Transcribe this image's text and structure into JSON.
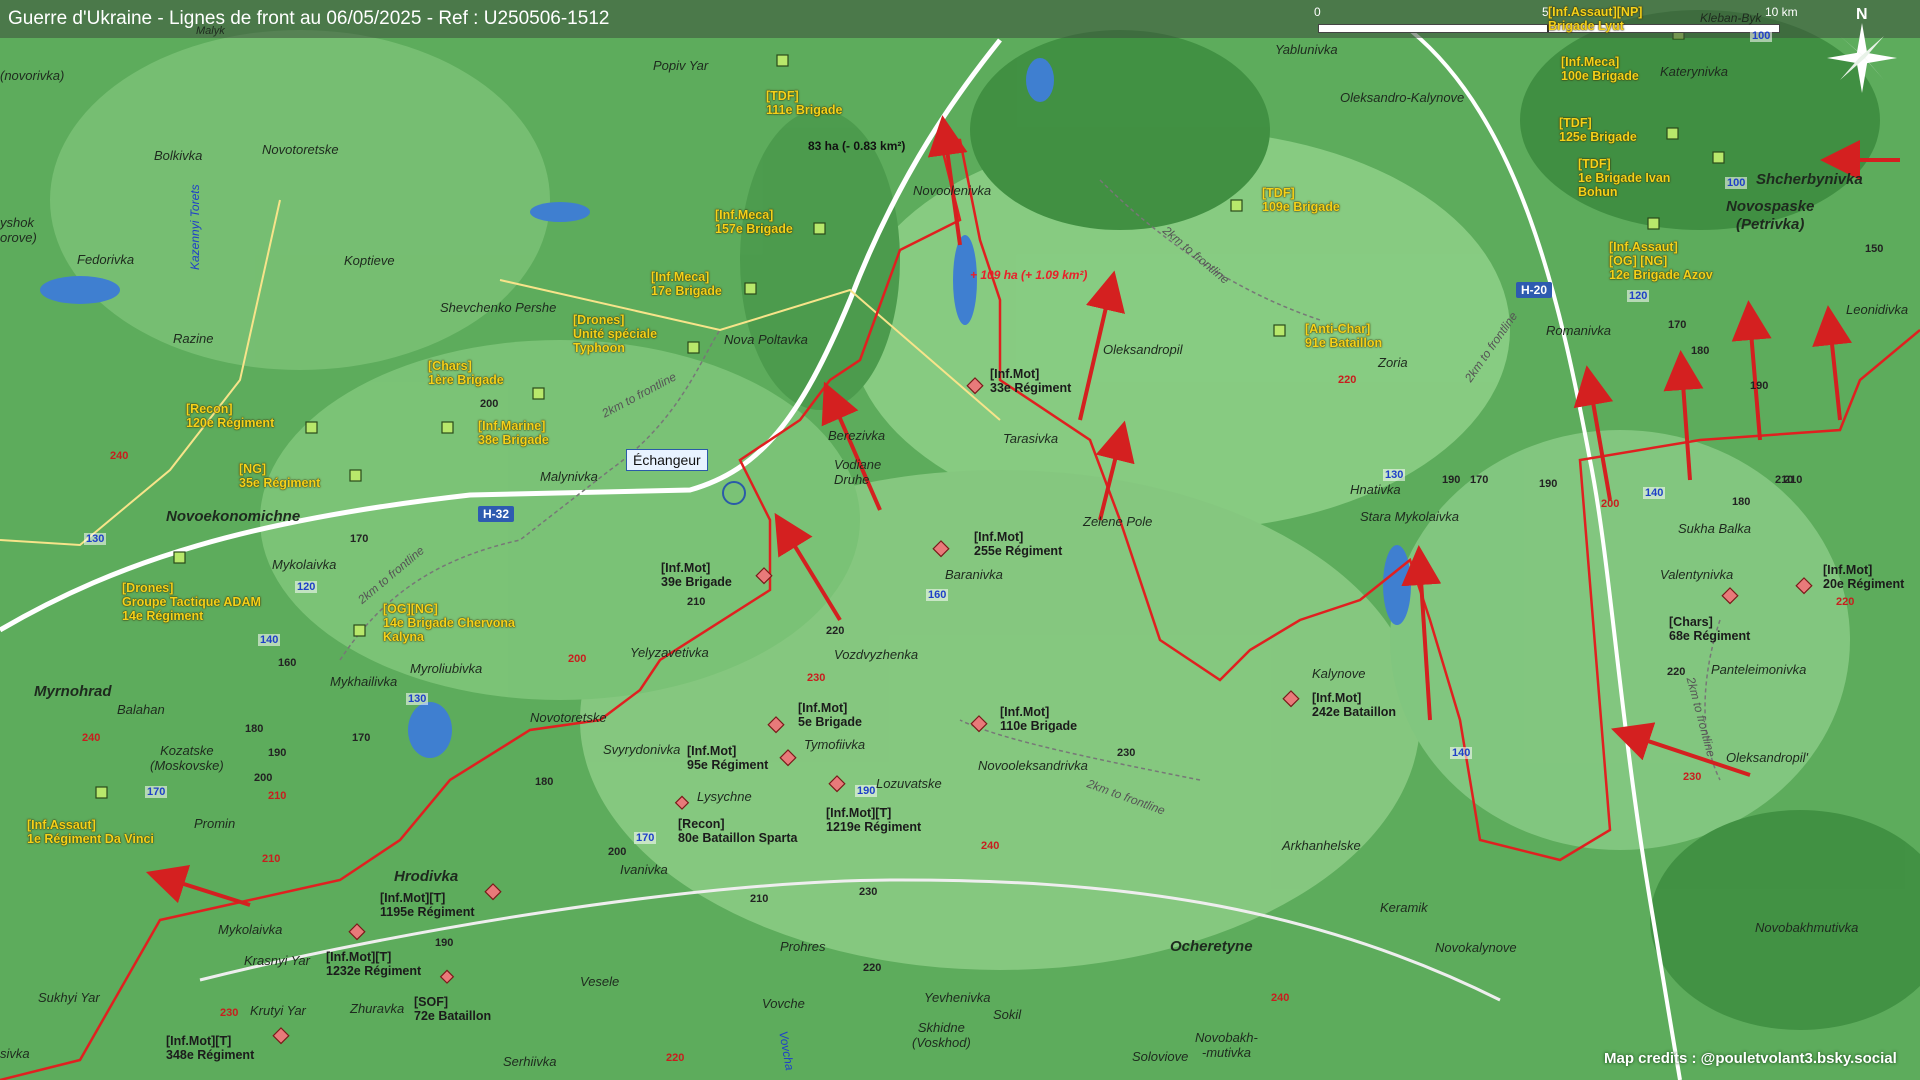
{
  "title": "Guerre d'Ukraine - Lignes de front au 06/05/2025 - Ref : U250506-1512",
  "scale": {
    "zero": "0",
    "mid": "5",
    "end": "10 km"
  },
  "north_label": "N",
  "interchange_label": "Échangeur",
  "credits": "Map credits : @pouletvolant3.bsky.social",
  "roads": {
    "h32": "H-32",
    "h20": "H-20"
  },
  "road_numbers": [
    "100",
    "100",
    "120",
    "130",
    "130",
    "140",
    "160",
    "170",
    "170",
    "190",
    "140",
    "120",
    "140",
    "130"
  ],
  "elevations": [
    "200",
    "240",
    "170",
    "160",
    "170",
    "190",
    "200",
    "180",
    "210",
    "200",
    "240",
    "210",
    "190",
    "210",
    "180",
    "200",
    "220",
    "230",
    "220",
    "210",
    "230",
    "220",
    "240",
    "230",
    "240",
    "220",
    "230",
    "220",
    "200",
    "210",
    "220",
    "230",
    "170",
    "180",
    "190",
    "150",
    "170",
    "190",
    "180",
    "210",
    "190"
  ],
  "changes": {
    "gain": "+ 109 ha (+ 1.09 km²)",
    "loss": "83 ha (- 0.83 km²)"
  },
  "frontline_label": "2km to frontline",
  "colors": {
    "ua_unit": "#f5d21a",
    "ru_unit": "#e87a7a",
    "front": "#e02020",
    "road": "#2e5bb0"
  },
  "places": {
    "popiv_yar": "Popiv Yar",
    "malyk": "Malyk",
    "novorivka": "(novorivka)",
    "bokivka": "Bolkivka",
    "novotoretske_n": "Novotoretske",
    "vyshok": "yshok\norove)",
    "fedorivka": "Fedorivka",
    "koptieve": "Koptieve",
    "razine": "Razine",
    "kazennyi_torets": "Kazennyi Torets",
    "shevchenko": "Shevchenko Pershe",
    "nova_poltavka": "Nova Poltavka",
    "novoolenivka": "Novoolenivka",
    "yablunivka": "Yablunivka",
    "oleksandro_kalynove": "Oleksandro-Kalynove",
    "kleban_byk": "Kleban-Byk",
    "katerynivka": "Katerynivka",
    "shcherbynivka": "Shcherbynivka",
    "novospaske": "Novospaske\n(Petrivka)",
    "leonidivka": "Leonidivka",
    "romanivka": "Romanivka",
    "zoria": "Zoria",
    "oleksandropil": "Oleksandropil",
    "tarasivka": "Tarasivka",
    "berezivka": "Berezivka",
    "vodiane": "Vodiane\nDruhe",
    "malynivka": "Malynivka",
    "novoekonomichne": "Novoekonomichne",
    "mykolaivka_n": "Mykolaivka",
    "zelene_pole": "Zelene Pole",
    "hnativka": "Hnativka",
    "stara_mykolaivka": "Stara Mykolaivka",
    "sukha_balka": "Sukha Balka",
    "valentynivka": "Valentynivka",
    "baranivka": "Baranivka",
    "vozdvyzhenka": "Vozdvyzhenka",
    "yelyzavetivka": "Yelyzavetivka",
    "myroliubivka": "Myroliubivka",
    "mykhailivka": "Mykhailivka",
    "myrnohrad": "Myrnohrad",
    "balahan": "Balahan",
    "kozatske": "Kozatske\n(Moskovske)",
    "novotoretske_s": "Novotoretske",
    "svyrydonivka": "Svyrydonivka",
    "tymofiivka": "Tymofiivka",
    "lysychne": "Lysychne",
    "lozuvatske": "Lozuvatske",
    "novooleksandrivka": "Novooleksandrivka",
    "kalynove": "Kalynove",
    "panteleimonivka": "Panteleimonivka",
    "oleksandropil_s": "Oleksandropil'",
    "promin": "Promin",
    "hrodivka": "Hrodivka",
    "ivanivka": "Ivanivka",
    "arkhanhelske": "Arkhanhelske",
    "keramik": "Keramik",
    "novokalynove": "Novokalynove",
    "novobakhmutivka": "Novobakhmutivka",
    "ocheretyne": "Ocheretyne",
    "mykolaivka_s": "Mykolaivka",
    "krasnyi_yar": "Krasnyi Yar",
    "sukhyi_yar": "Sukhyi Yar",
    "krutyi_yar": "Krutyi Yar",
    "zhuravka": "Zhuravka",
    "prohres": "Prohres",
    "vesele": "Vesele",
    "vovche": "Vovche",
    "yevhenivka": "Yevhenivka",
    "sokil": "Sokil",
    "skhidne": "Skhidne\n(Voskhod)",
    "novobakhmutivka_s": "Novobakh-\n-mutivka",
    "soloviove": "Soloviove",
    "serhiivka": "Serhiivka",
    "vovcha": "Vovcha",
    "rysivka": "sivka"
  },
  "units_ua": [
    {
      "id": "tdf111",
      "text": "[TDF]\n111e Brigade"
    },
    {
      "id": "inf157",
      "text": "[Inf.Meca]\n157e Brigade"
    },
    {
      "id": "inf17",
      "text": "[Inf.Meca]\n17e Brigade"
    },
    {
      "id": "drones_typhoon",
      "text": "[Drones]\nUnité spéciale\nTyphoon"
    },
    {
      "id": "chars1",
      "text": "[Chars]\n1ère Brigade"
    },
    {
      "id": "recon120",
      "text": "[Recon]\n120e Régiment"
    },
    {
      "id": "marine38",
      "text": "[Inf.Marine]\n38e Brigade"
    },
    {
      "id": "ng35",
      "text": "[NG]\n35e Régiment"
    },
    {
      "id": "drones_adam",
      "text": "[Drones]\nGroupe Tactique ADAM\n14e Régiment"
    },
    {
      "id": "og14",
      "text": "[OG][NG]\n14e Brigade Chervona\nKalyna"
    },
    {
      "id": "assault1",
      "text": "[Inf.Assaut]\n1e Régiment Da Vinci"
    },
    {
      "id": "tdf109",
      "text": "[TDF]\n109e Brigade"
    },
    {
      "id": "antichar91",
      "text": "[Anti-Char]\n91e Bataillon"
    },
    {
      "id": "assault_lyut",
      "text": "[Inf.Assaut][NP]\nBrigade Lyut"
    },
    {
      "id": "meca100",
      "text": "[Inf.Meca]\n100e Brigade"
    },
    {
      "id": "tdf125",
      "text": "[TDF]\n125e Brigade"
    },
    {
      "id": "tdf1",
      "text": "[TDF]\n1e Brigade Ivan\nBohun"
    },
    {
      "id": "azov12",
      "text": "[Inf.Assaut]\n[OG] [NG]\n12e Brigade Azov"
    }
  ],
  "units_ru": [
    {
      "id": "mot33",
      "text": "[Inf.Mot]\n33e Régiment"
    },
    {
      "id": "mot255",
      "text": "[Inf.Mot]\n255e Régiment"
    },
    {
      "id": "mot39",
      "text": "[Inf.Mot]\n39e Brigade"
    },
    {
      "id": "mot5",
      "text": "[Inf.Mot]\n5e Brigade"
    },
    {
      "id": "mot95",
      "text": "[Inf.Mot]\n95e Régiment"
    },
    {
      "id": "mot110",
      "text": "[Inf.Mot]\n110e Brigade"
    },
    {
      "id": "recon80",
      "text": "[Recon]\n80e Bataillon Sparta"
    },
    {
      "id": "mot1219",
      "text": "[Inf.Mot][T]\n1219e Régiment"
    },
    {
      "id": "mot242",
      "text": "[Inf.Mot]\n242e Bataillon"
    },
    {
      "id": "chars68",
      "text": "[Chars]\n68e Régiment"
    },
    {
      "id": "mot20",
      "text": "[Inf.Mot]\n20e Régiment"
    },
    {
      "id": "mot1195",
      "text": "[Inf.Mot][T]\n1195e Régiment"
    },
    {
      "id": "mot1232",
      "text": "[Inf.Mot][T]\n1232e Régiment"
    },
    {
      "id": "sof72",
      "text": "[SOF]\n72e Bataillon"
    },
    {
      "id": "mot348",
      "text": "[Inf.Mot][T]\n348e Régiment"
    }
  ]
}
